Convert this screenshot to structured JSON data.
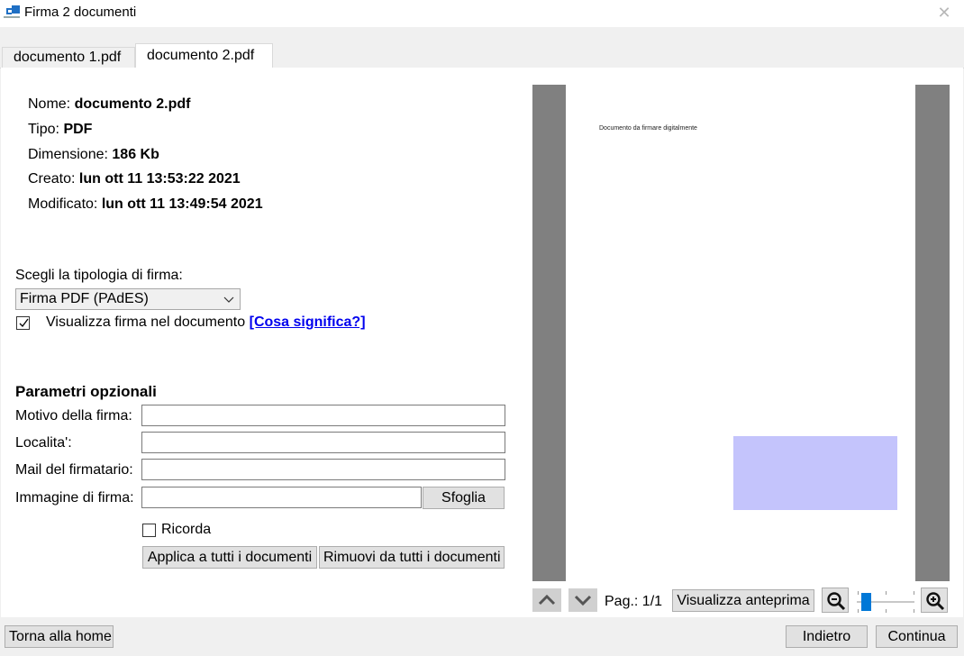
{
  "window": {
    "title": "Firma 2 documenti",
    "icon": "app-logo-icon",
    "close_icon": "close-icon"
  },
  "tabs": [
    {
      "label": "documento 1.pdf",
      "active": false
    },
    {
      "label": "documento 2.pdf",
      "active": true
    }
  ],
  "file_info": {
    "name_label": "Nome:",
    "name_value": "documento 2.pdf",
    "type_label": "Tipo:",
    "type_value": "PDF",
    "size_label": "Dimensione:",
    "size_value": "186 Kb",
    "created_label": "Creato:",
    "created_value": "lun ott 11 13:53:22 2021",
    "modified_label": "Modificato:",
    "modified_value": "lun ott 11 13:49:54 2021"
  },
  "signature_type": {
    "label": "Scegli la tipologia di firma:",
    "selected": "Firma PDF (PAdES)"
  },
  "show_signature": {
    "checked": true,
    "label": "Visualizza firma nel documento",
    "link_text": "[Cosa significa?]"
  },
  "optional_params": {
    "title": "Parametri opzionali",
    "reason_label": "Motivo della firma:",
    "reason_value": "",
    "location_label": "Localita':",
    "location_value": "",
    "email_label": "Mail del firmatario:",
    "email_value": "",
    "image_label": "Immagine di firma:",
    "image_value": "",
    "browse_button": "Sfoglia",
    "remember_label": "Ricorda",
    "remember_checked": false,
    "apply_all_button": "Applica a tutti i documenti",
    "remove_all_button": "Rimuovi da tutti i documenti"
  },
  "preview": {
    "page_text": "Documento da firmare digitalmente",
    "signature_box_color": "#c4c4fc",
    "page_label": "Pag.: 1/1",
    "preview_button": "Visualizza anteprima",
    "zoom_level": 0.05
  },
  "footer": {
    "home_button": "Torna alla home",
    "back_button": "Indietro",
    "continue_button": "Continua"
  }
}
